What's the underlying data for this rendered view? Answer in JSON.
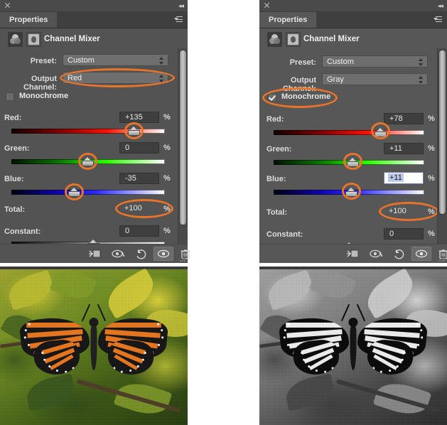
{
  "window": {
    "close_icon": "close-icon",
    "collapse_icon": "collapse-panel-icon",
    "menu_icon": "panel-menu-icon"
  },
  "panels": [
    {
      "id": "left",
      "tab_label": "Properties",
      "adjustment_title": "Channel Mixer",
      "adjustment_icon": "channel-mixer-icon",
      "mask_icon": "layer-mask-icon",
      "preset_label": "Preset:",
      "preset_value": "Custom",
      "output_channel_label": "Output Channel:",
      "output_channel_value": "Red",
      "monochrome_label": "Monochrome",
      "monochrome_checked": false,
      "sliders": [
        {
          "label": "Red:",
          "value": "+135",
          "unit": "%",
          "pos": 0.8,
          "color": "red"
        },
        {
          "label": "Green:",
          "value": "0",
          "unit": "%",
          "pos": 0.48,
          "color": "green"
        },
        {
          "label": "Blue:",
          "value": "-35",
          "unit": "%",
          "pos": 0.39,
          "color": "blue"
        }
      ],
      "total_label": "Total:",
      "total_value": "+100",
      "total_unit": "%",
      "constant_label": "Constant:",
      "constant_value": "0",
      "constant_unit": "%",
      "constant_pos": 0.5,
      "toolbar": [
        {
          "name": "clip-to-layer-button",
          "icon": "clip-to-layer-icon",
          "active": false
        },
        {
          "name": "view-previous-state-button",
          "icon": "eye-previous-icon",
          "active": false
        },
        {
          "name": "reset-button",
          "icon": "reset-icon",
          "active": false
        },
        {
          "name": "toggle-visibility-button",
          "icon": "eye-icon",
          "active": true
        },
        {
          "name": "delete-button",
          "icon": "trash-icon",
          "active": false
        }
      ],
      "annotations": [
        "output-channel-highlight",
        "red-slider-thumb-highlight",
        "green-slider-thumb-highlight",
        "blue-slider-thumb-highlight",
        "total-highlight"
      ]
    },
    {
      "id": "right",
      "tab_label": "Properties",
      "adjustment_title": "Channel Mixer",
      "adjustment_icon": "channel-mixer-icon",
      "mask_icon": "layer-mask-icon",
      "preset_label": "Preset:",
      "preset_value": "Custom",
      "output_channel_label": "Output Channel:",
      "output_channel_value": "Gray",
      "monochrome_label": "Monochrome",
      "monochrome_checked": true,
      "sliders": [
        {
          "label": "Red:",
          "value": "+78",
          "unit": "%",
          "pos": 0.735,
          "color": "red",
          "focused": false
        },
        {
          "label": "Green:",
          "value": "+11",
          "unit": "%",
          "pos": 0.505,
          "color": "green",
          "focused": false
        },
        {
          "label": "Blue:",
          "value": "+11",
          "unit": "%",
          "pos": 0.505,
          "color": "blue",
          "focused": true
        }
      ],
      "total_label": "Total:",
      "total_value": "+100",
      "total_unit": "%",
      "constant_label": "Constant:",
      "constant_value": "0",
      "constant_unit": "%",
      "constant_pos": 0.5,
      "toolbar": [
        {
          "name": "clip-to-layer-button",
          "icon": "clip-to-layer-icon",
          "active": false
        },
        {
          "name": "view-previous-state-button",
          "icon": "eye-previous-icon",
          "active": false
        },
        {
          "name": "reset-button",
          "icon": "reset-icon",
          "active": false
        },
        {
          "name": "toggle-visibility-button",
          "icon": "eye-icon",
          "active": true
        },
        {
          "name": "delete-button",
          "icon": "trash-icon",
          "active": false
        }
      ],
      "annotations": [
        "monochrome-highlight",
        "red-slider-thumb-highlight",
        "green-slider-thumb-highlight",
        "blue-slider-thumb-highlight",
        "total-highlight"
      ]
    }
  ],
  "photos": {
    "left": {
      "name": "color-photo-monarch-butterfly",
      "description": "Monarch butterfly on yellow-green leaves, color"
    },
    "right": {
      "name": "grayscale-photo-monarch-butterfly",
      "description": "Monarch butterfly on leaves, black and white"
    }
  },
  "colors": {
    "panel_bg": "#535353",
    "panel_bg_alt": "#575757",
    "tab_bg": "#3f3f3f",
    "annotation": "#e8732a",
    "field_bg": "#3f3f3f",
    "select_bg": "#6e6e6e",
    "focus_border": "#6a7fb5"
  }
}
